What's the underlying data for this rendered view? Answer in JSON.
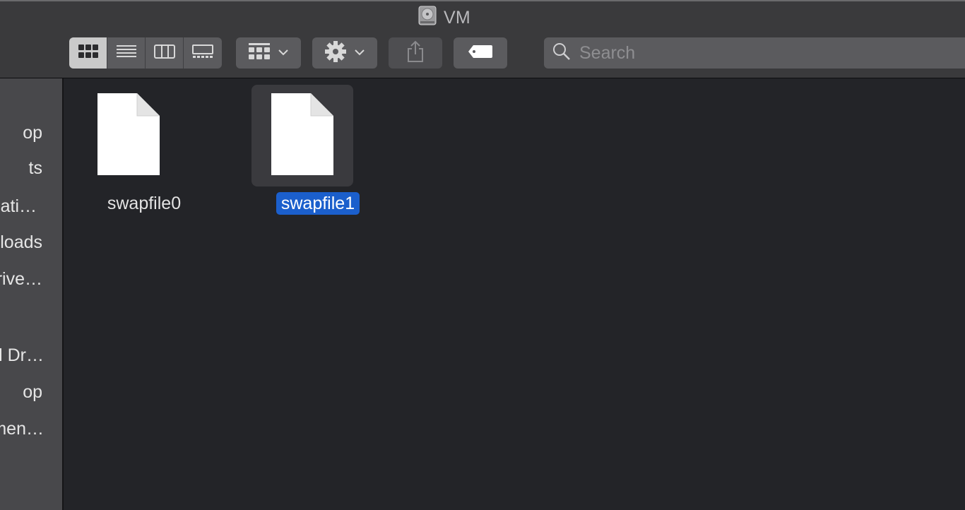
{
  "window": {
    "title": "VM"
  },
  "toolbar": {
    "view_modes": [
      {
        "name": "icon-view",
        "active": true
      },
      {
        "name": "list-view",
        "active": false
      },
      {
        "name": "column-view",
        "active": false
      },
      {
        "name": "gallery-view",
        "active": false
      }
    ],
    "group_button": {
      "icon": "group-grid-icon"
    },
    "action_button": {
      "icon": "gear-icon"
    },
    "share_button": {
      "icon": "share-icon"
    },
    "tags_button": {
      "icon": "tag-icon"
    },
    "search": {
      "placeholder": "Search",
      "value": ""
    }
  },
  "sidebar": {
    "items": [
      {
        "label": "op"
      },
      {
        "label": "ts"
      },
      {
        "label": "cati…"
      },
      {
        "label": "loads"
      },
      {
        "label": "rive…"
      },
      {
        "label": "l Dr…"
      },
      {
        "label": "op"
      },
      {
        "label": "men…"
      }
    ]
  },
  "files": [
    {
      "name": "swapfile0",
      "selected": false
    },
    {
      "name": "swapfile1",
      "selected": true
    }
  ],
  "colors": {
    "toolbar_bg": "#3a3a3c",
    "content_bg": "#232428",
    "sidebar_bg": "#48484b",
    "selection": "#1b5fcc"
  }
}
